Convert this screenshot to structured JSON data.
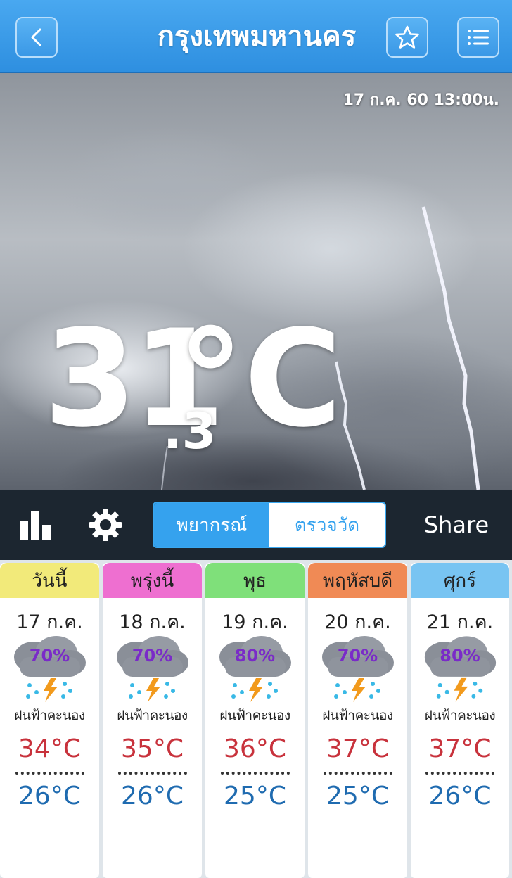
{
  "header": {
    "title": "กรุงเทพมหานคร",
    "back_icon": "chevron-left-icon",
    "favorite_icon": "star-icon",
    "menu_icon": "list-icon"
  },
  "hero": {
    "datetime": "17 ก.ค. 60 13:00น.",
    "temp_whole": "31",
    "temp_decimal": ".3",
    "temp_unit": "°C"
  },
  "toolbar": {
    "stats_icon": "bar-chart-icon",
    "settings_icon": "gear-icon",
    "tabs": [
      {
        "label": "พยากรณ์",
        "active": true
      },
      {
        "label": "ตรวจวัด",
        "active": false
      }
    ],
    "share_label": "Share"
  },
  "forecast": [
    {
      "day": "วันนี้",
      "date": "17 ก.ค.",
      "rain_chance": "70%",
      "condition": "ฝนฟ้าคะนอง",
      "high": "34°C",
      "low": "26°C",
      "tab_color": "#f2ea7a"
    },
    {
      "day": "พรุ่งนี้",
      "date": "18 ก.ค.",
      "rain_chance": "70%",
      "condition": "ฝนฟ้าคะนอง",
      "high": "35°C",
      "low": "26°C",
      "tab_color": "#ee6fd0"
    },
    {
      "day": "พุธ",
      "date": "19 ก.ค.",
      "rain_chance": "80%",
      "condition": "ฝนฟ้าคะนอง",
      "high": "36°C",
      "low": "25°C",
      "tab_color": "#7fe07a"
    },
    {
      "day": "พฤหัสบดี",
      "date": "20 ก.ค.",
      "rain_chance": "70%",
      "condition": "ฝนฟ้าคะนอง",
      "high": "37°C",
      "low": "25°C",
      "tab_color": "#f08a55"
    },
    {
      "day": "ศุกร์",
      "date": "21 ก.ค.",
      "rain_chance": "80%",
      "condition": "ฝนฟ้าคะนอง",
      "high": "37°C",
      "low": "26°C",
      "tab_color": "#78c4f2"
    }
  ]
}
